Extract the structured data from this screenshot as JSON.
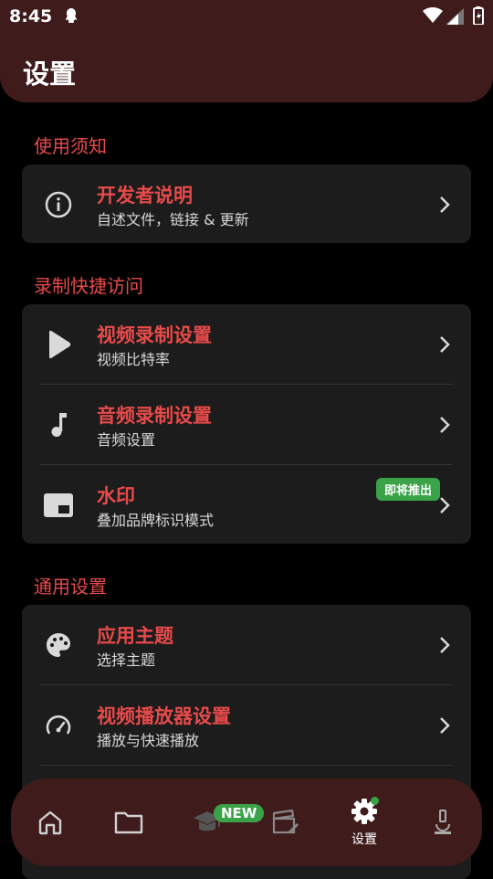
{
  "status_bar": {
    "time": "8:45"
  },
  "header": {
    "title": "设置"
  },
  "sections": [
    {
      "title": "使用须知",
      "items": [
        {
          "title": "开发者说明",
          "subtitle": "自述文件，链接 & 更新",
          "icon": "info-icon"
        }
      ]
    },
    {
      "title": "录制快捷访问",
      "items": [
        {
          "title": "视频录制设置",
          "subtitle": "视频比特率",
          "icon": "play-icon"
        },
        {
          "title": "音频录制设置",
          "subtitle": "音频设置",
          "icon": "music-note-icon"
        },
        {
          "title": "水印",
          "subtitle": "叠加品牌标识模式",
          "icon": "picture-in-picture-icon",
          "badge": "即将推出"
        }
      ]
    },
    {
      "title": "通用设置",
      "items": [
        {
          "title": "应用主题",
          "subtitle": "选择主题",
          "icon": "palette-icon"
        },
        {
          "title": "视频播放器设置",
          "subtitle": "播放与快速播放",
          "icon": "speedometer-icon"
        }
      ]
    }
  ],
  "bottom_nav": {
    "items": [
      {
        "icon": "home-icon"
      },
      {
        "icon": "folder-icon"
      },
      {
        "icon": "graduation-icon",
        "badge": "NEW"
      },
      {
        "icon": "clapperboard-icon"
      },
      {
        "icon": "gear-icon",
        "label": "设置",
        "active": true
      },
      {
        "icon": "microscope-icon"
      }
    ]
  },
  "colors": {
    "accent": "#e84a4a",
    "header_bg": "#3f1c1b",
    "card_bg": "#1c1c1c",
    "badge_green": "#3aa348"
  }
}
